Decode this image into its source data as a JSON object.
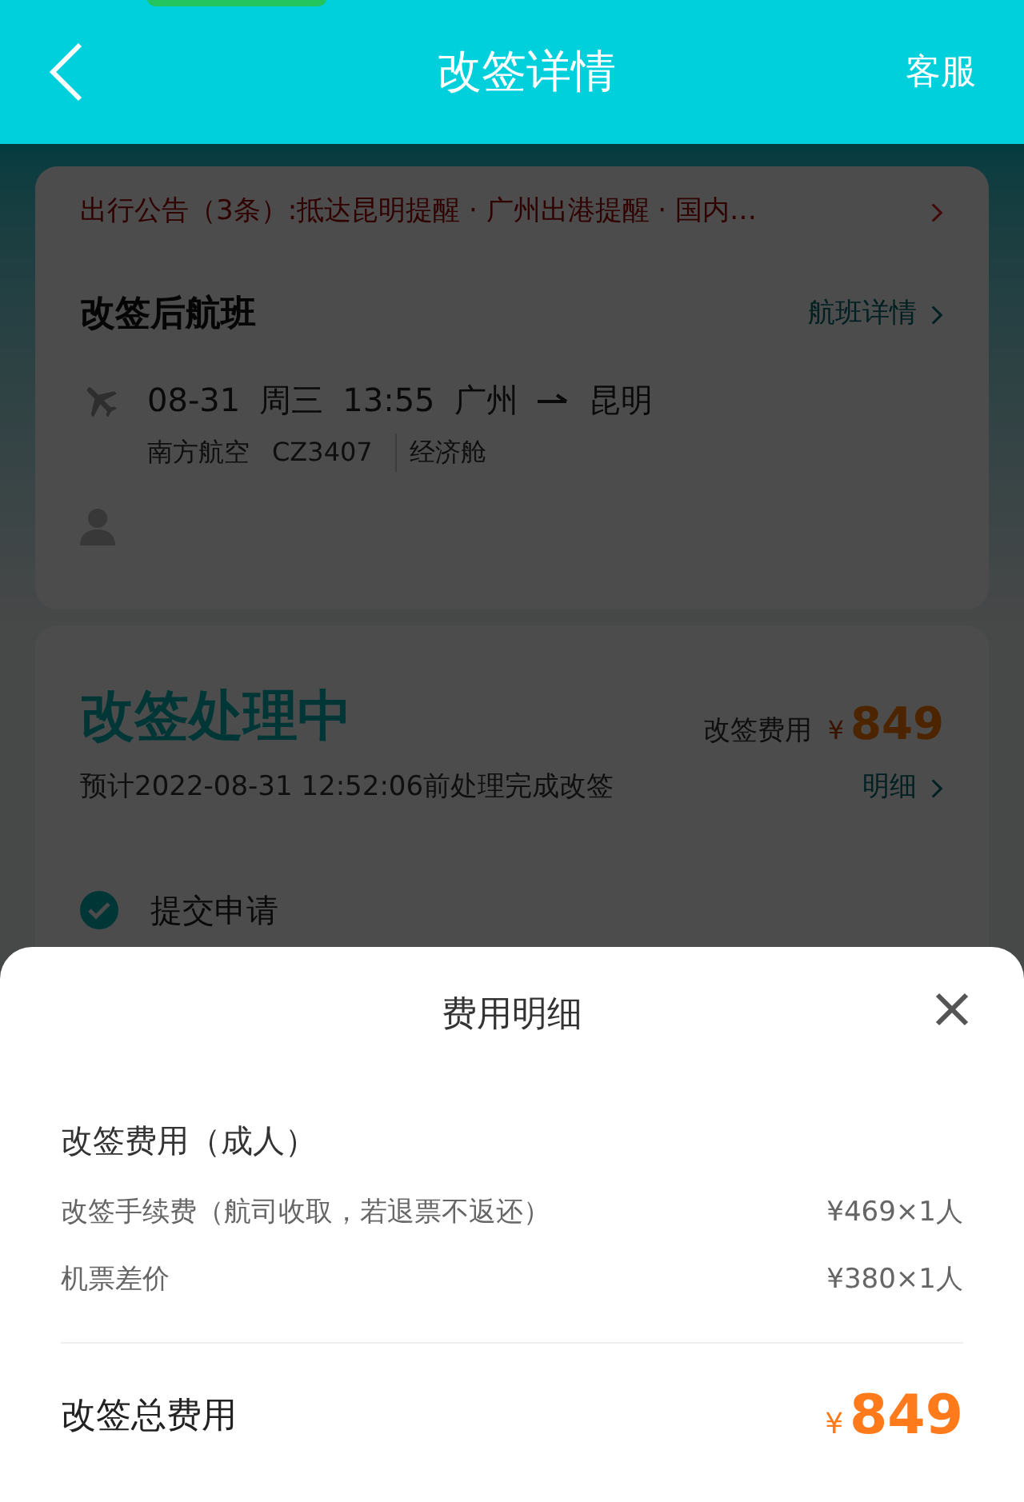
{
  "header": {
    "title": "改签详情",
    "action": "客服"
  },
  "notice": {
    "text": "出行公告（3条）:抵达昆明提醒 · 广州出港提醒 · 国内…"
  },
  "flight": {
    "heading": "改签后航班",
    "link": "航班详情",
    "date": "08-31",
    "weekday": "周三",
    "time": "13:55",
    "from": "广州",
    "to": "昆明",
    "airline": "南方航空",
    "flight_no": "CZ3407",
    "cabin": "经济舱"
  },
  "status": {
    "title": "改签处理中",
    "fee_label": "改签费用",
    "currency": "¥",
    "fee": "849",
    "eta": "预计2022-08-31 12:52:06前处理完成改签",
    "detail_link": "明细"
  },
  "steps": [
    {
      "label": "提交申请",
      "done": true
    }
  ],
  "sheet": {
    "title": "费用明细",
    "section": "改签费用（成人）",
    "rows": [
      {
        "label": "改签手续费（航司收取，若退票不返还）",
        "amount": "¥469×1人"
      },
      {
        "label": "机票差价",
        "amount": "¥380×1人"
      }
    ],
    "total_label": "改签总费用",
    "currency": "¥",
    "total": "849"
  }
}
